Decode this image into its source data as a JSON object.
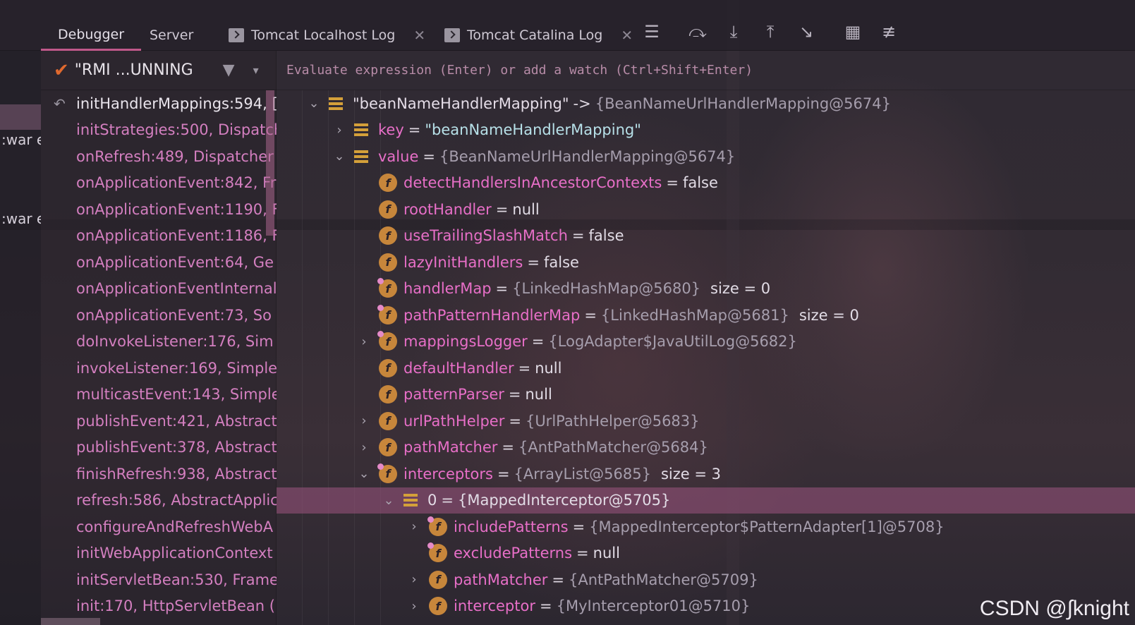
{
  "tabs": [
    {
      "label": "Debugger",
      "active": true
    },
    {
      "label": "Server",
      "active": false
    },
    {
      "label": "Tomcat Localhost Log",
      "active": false,
      "closable": true
    },
    {
      "label": "Tomcat Catalina Log",
      "active": false,
      "closable": true
    }
  ],
  "toolbar_icons": [
    "layout-icon",
    "step-over-icon",
    "step-into-icon",
    "step-out-icon",
    "run-to-cursor-icon",
    "evaluate-icon",
    "trace-icon"
  ],
  "left_strip": {
    "fragment_1": ":war e",
    "fragment_2": ":war e"
  },
  "thread": {
    "name": "\"RMI ...UNNING"
  },
  "frames": [
    "initHandlerMappings:594, [",
    "initStrategies:500, Dispatch",
    "onRefresh:489, Dispatcher",
    "onApplicationEvent:842, Fr",
    "onApplicationEvent:1190, F",
    "onApplicationEvent:1186, F",
    "onApplicationEvent:64, Ge",
    "onApplicationEventInternal",
    "onApplicationEvent:73, So",
    "doInvokeListener:176, Sim",
    "invokeListener:169, Simple",
    "multicastEvent:143, Simple",
    "publishEvent:421, Abstract",
    "publishEvent:378, Abstract",
    "finishRefresh:938, Abstract",
    "refresh:586, AbstractApplic",
    "configureAndRefreshWebA",
    "initWebApplicationContext",
    "initServletBean:530, Frame",
    "init:170, HttpServletBean ("
  ],
  "eval": {
    "placeholder": "Evaluate expression (Enter) or add a watch (Ctrl+Shift+Enter)"
  },
  "variables": [
    {
      "indent": 0,
      "chev": "v",
      "icon": "array",
      "name": "\"beanNameHandlerMapping\"",
      "name_style": "str",
      "sep": "->",
      "value": "{BeanNameUrlHandlerMapping@5674}"
    },
    {
      "indent": 1,
      "chev": ">",
      "icon": "array",
      "name": "key",
      "sep": "=",
      "value": "\"beanNameHandlerMapping\"",
      "value_style": "strval"
    },
    {
      "indent": 1,
      "chev": "v",
      "icon": "array",
      "name": "value",
      "sep": "=",
      "value": "{BeanNameUrlHandlerMapping@5674}"
    },
    {
      "indent": 2,
      "chev": "",
      "icon": "field",
      "name": "detectHandlersInAncestorContexts",
      "sep": "=",
      "value": "false",
      "value_style": "plain"
    },
    {
      "indent": 2,
      "chev": "",
      "icon": "field",
      "name": "rootHandler",
      "sep": "=",
      "value": "null",
      "value_style": "plain"
    },
    {
      "indent": 2,
      "chev": "",
      "icon": "field",
      "name": "useTrailingSlashMatch",
      "sep": "=",
      "value": "false",
      "value_style": "plain"
    },
    {
      "indent": 2,
      "chev": "",
      "icon": "field",
      "name": "lazyInitHandlers",
      "sep": "=",
      "value": "false",
      "value_style": "plain"
    },
    {
      "indent": 2,
      "chev": "",
      "icon": "field-pinned",
      "name": "handlerMap",
      "sep": "=",
      "value": "{LinkedHashMap@5680}",
      "size": "size = 0"
    },
    {
      "indent": 2,
      "chev": "",
      "icon": "field-pinned",
      "name": "pathPatternHandlerMap",
      "sep": "=",
      "value": "{LinkedHashMap@5681}",
      "size": "size = 0"
    },
    {
      "indent": 2,
      "chev": ">",
      "icon": "field-pinned",
      "name": "mappingsLogger",
      "sep": "=",
      "value": "{LogAdapter$JavaUtilLog@5682}"
    },
    {
      "indent": 2,
      "chev": "",
      "icon": "field",
      "name": "defaultHandler",
      "sep": "=",
      "value": "null",
      "value_style": "plain"
    },
    {
      "indent": 2,
      "chev": "",
      "icon": "field",
      "name": "patternParser",
      "sep": "=",
      "value": "null",
      "value_style": "plain"
    },
    {
      "indent": 2,
      "chev": ">",
      "icon": "field",
      "name": "urlPathHelper",
      "sep": "=",
      "value": "{UrlPathHelper@5683}"
    },
    {
      "indent": 2,
      "chev": ">",
      "icon": "field",
      "name": "pathMatcher",
      "sep": "=",
      "value": "{AntPathMatcher@5684}"
    },
    {
      "indent": 2,
      "chev": "v",
      "icon": "field-pinned",
      "name": "interceptors",
      "sep": "=",
      "value": "{ArrayList@5685}",
      "size": "size = 3"
    },
    {
      "indent": 3,
      "chev": "v",
      "icon": "array",
      "name": "0",
      "name_style": "str",
      "sep": "=",
      "value": "{MappedInterceptor@5705}",
      "value_style": "plain",
      "selected": true
    },
    {
      "indent": 4,
      "chev": ">",
      "icon": "field-pinned",
      "name": "includePatterns",
      "sep": "=",
      "value": "{MappedInterceptor$PatternAdapter[1]@5708}"
    },
    {
      "indent": 4,
      "chev": "",
      "icon": "field-pinned",
      "name": "excludePatterns",
      "sep": "=",
      "value": "null",
      "value_style": "plain"
    },
    {
      "indent": 4,
      "chev": ">",
      "icon": "field",
      "name": "pathMatcher",
      "sep": "=",
      "value": "{AntPathMatcher@5709}"
    },
    {
      "indent": 4,
      "chev": ">",
      "icon": "field",
      "name": "interceptor",
      "sep": "=",
      "value": "{MyInterceptor01@5710}"
    }
  ],
  "watermark": "CSDN @∫knight"
}
